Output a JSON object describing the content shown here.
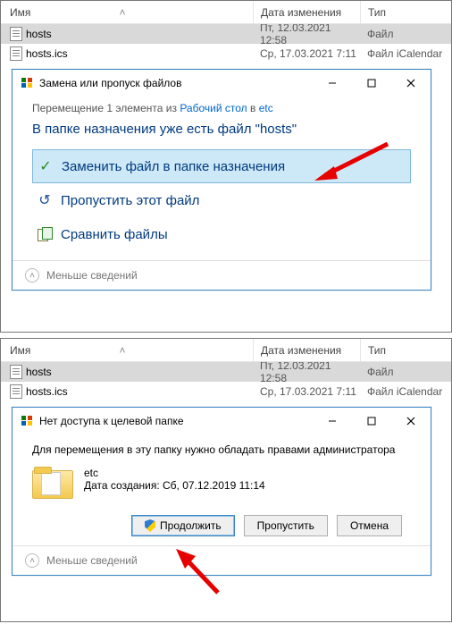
{
  "top": {
    "headers": {
      "name": "Имя",
      "date": "Дата изменения",
      "type": "Тип"
    },
    "rows": [
      {
        "name": "hosts",
        "date": "Пт, 12.03.2021 12:58",
        "type": "Файл"
      },
      {
        "name": "hosts.ics",
        "date": "Ср, 17.03.2021 7:11",
        "type": "Файл iCalendar"
      }
    ],
    "dialog": {
      "title": "Замена или пропуск файлов",
      "move_prefix": "Перемещение 1 элемента из ",
      "link1": "Рабочий стол",
      "move_mid": " в ",
      "link2": "etc",
      "headline": "В папке назначения уже есть файл \"hosts\"",
      "opt1": "Заменить файл в папке назначения",
      "opt2": "Пропустить этот файл",
      "opt3": "Сравнить файлы",
      "less": "Меньше сведений"
    }
  },
  "bottom": {
    "headers": {
      "name": "Имя",
      "date": "Дата изменения",
      "type": "Тип"
    },
    "rows": [
      {
        "name": "hosts",
        "date": "Пт, 12.03.2021 12:58",
        "type": "Файл"
      },
      {
        "name": "hosts.ics",
        "date": "Ср, 17.03.2021 7:11",
        "type": "Файл iCalendar"
      }
    ],
    "dialog": {
      "title": "Нет доступа к целевой папке",
      "msg": "Для перемещения в эту папку нужно обладать правами администратора",
      "folder_name": "etc",
      "folder_date": "Дата создания: Сб, 07.12.2019 11:14",
      "btn_continue": "Продолжить",
      "btn_skip": "Пропустить",
      "btn_cancel": "Отмена",
      "less": "Меньше сведений"
    }
  }
}
